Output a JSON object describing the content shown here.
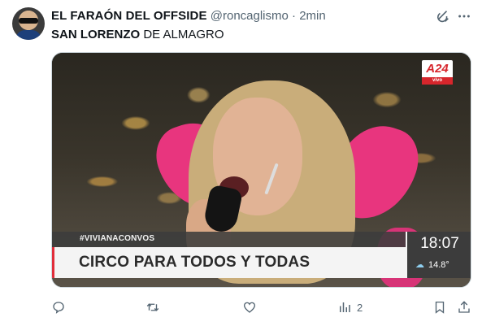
{
  "tweet": {
    "display_name": "EL FARAÓN DEL OFFSIDE",
    "handle": "@roncaglismo",
    "separator": "·",
    "time": "2min",
    "text_bold": "SAN LORENZO",
    "text_rest": " DE ALMAGRO"
  },
  "media": {
    "channel_logo": "A24",
    "channel_logo_sub": "vivo",
    "hashtag": "#VIVIANACONVOS",
    "headline": "CIRCO PARA TODOS Y TODAS",
    "clock": "18:07",
    "temperature": "14.8°"
  },
  "actions": {
    "reply_icon": "reply-icon",
    "retweet_icon": "retweet-icon",
    "like_icon": "heart-icon",
    "views_icon": "views-chart-icon",
    "views_count": "2",
    "bookmark_icon": "bookmark-icon",
    "share_icon": "share-icon"
  },
  "colors": {
    "text_primary": "#0f1419",
    "text_secondary": "#536471",
    "pink_chair": "#e8357e",
    "a24_red": "#d7262c"
  }
}
